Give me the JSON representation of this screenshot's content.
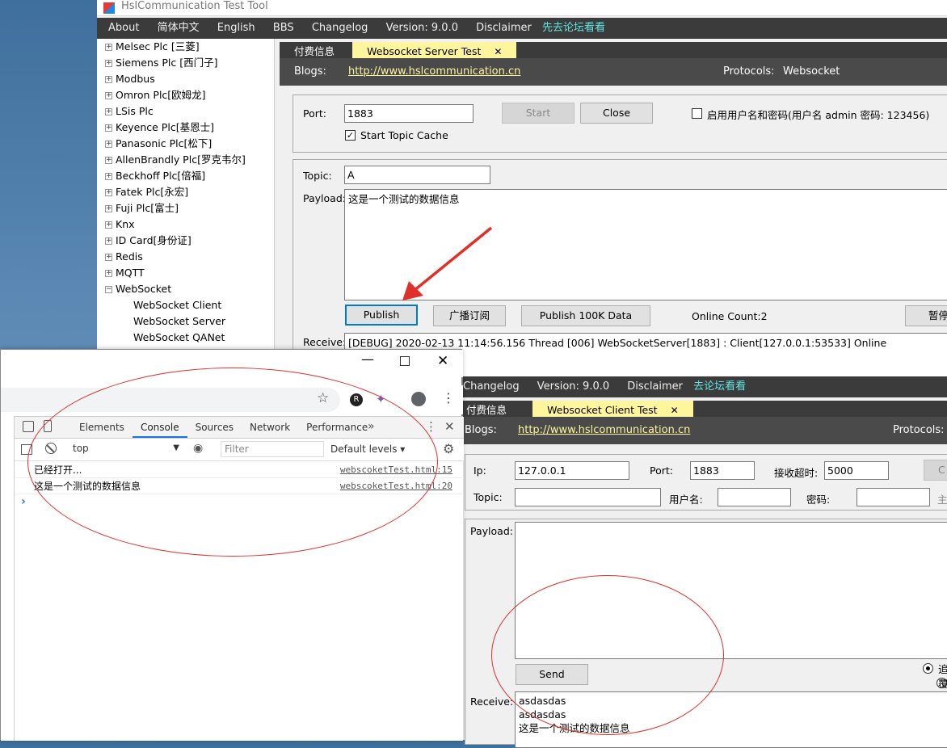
{
  "server_window": {
    "title": "HslCommunication Test Tool",
    "menu": [
      "About",
      "简体中文",
      "English",
      "BBS",
      "Changelog",
      "Version: 9.0.0",
      "Disclaimer",
      "先去论坛看看"
    ],
    "tree": {
      "items": [
        {
          "label": "Melsec Plc [三菱]"
        },
        {
          "label": "Siemens Plc [西门子]"
        },
        {
          "label": "Modbus"
        },
        {
          "label": "Omron Plc[欧姆龙]"
        },
        {
          "label": "LSis Plc"
        },
        {
          "label": "Keyence Plc[基恩士]"
        },
        {
          "label": "Panasonic Plc[松下]"
        },
        {
          "label": "AllenBrandly Plc[罗克韦尔]"
        },
        {
          "label": "Beckhoff Plc[倍福]"
        },
        {
          "label": "Fatek Plc[永宏]"
        },
        {
          "label": "Fuji Plc[富士]"
        },
        {
          "label": "Knx"
        },
        {
          "label": "ID Card[身份证]"
        },
        {
          "label": "Redis"
        },
        {
          "label": "MQTT"
        },
        {
          "label": "WebSocket"
        }
      ],
      "children": [
        "WebSocket Client",
        "WebSocket Server",
        "WebSocket QANet"
      ]
    },
    "tabs": [
      "付费信息",
      "Websocket Server Test"
    ],
    "blogs_label": "Blogs:",
    "blogs_url": "http://www.hslcommunication.cn",
    "protocols_label": "Protocols:",
    "protocols_value": "Websocket",
    "port_label": "Port:",
    "port_value": "1883",
    "start_label": "Start",
    "close_label": "Close",
    "auth_label": "启用用户名和密码(用户名 admin  密码: 123456)",
    "topic_cache_label": "Start Topic Cache",
    "topic_label": "Topic:",
    "topic_value": "A",
    "payload_label": "Payload:",
    "payload_value": "这是一个测试的数据信息",
    "publish_label": "Publish",
    "broadcast_label": "广播订阅",
    "publish100k_label": "Publish 100K Data",
    "online_count": "Online Count:2",
    "pause_label": "暂停",
    "receive_label": "Receive:",
    "receive_line": "[DEBUG] 2020-02-13 11:14:56.156 Thread [006] WebSocketServer[1883] : Client[127.0.0.1:53533] Online"
  },
  "client_window": {
    "menu": [
      "Changelog",
      "Version: 9.0.0",
      "Disclaimer",
      "去论坛看看"
    ],
    "tabs": [
      "付费信息",
      "Websocket Client Test"
    ],
    "blogs_label": "Blogs:",
    "blogs_url": "http://www.hslcommunication.cn",
    "protocols_label": "Protocols:",
    "ip_label": "Ip:",
    "ip_value": "127.0.0.1",
    "port_label": "Port:",
    "port_value": "1883",
    "timeout_label": "接收超时:",
    "timeout_value": "5000",
    "connect_partial": "C",
    "topic_label": "Topic:",
    "user_label": "用户名:",
    "pwd_label": "密码:",
    "extra_partial": "主",
    "payload_label": "Payload:",
    "send_label": "Send",
    "radio1_partial": "追",
    "radio2_partial": "覆",
    "receive_label": "Receive:",
    "receive_lines": [
      "asdasdas",
      "asdasdas",
      "这是一个测试的数据信息"
    ]
  },
  "browser": {
    "devtools_tabs": [
      "Elements",
      "Console",
      "Sources",
      "Network",
      "Performance"
    ],
    "context": "top",
    "filter_placeholder": "Filter",
    "levels": "Default levels ▾",
    "console_lines": [
      {
        "text": "已经打开...",
        "src": "webscoketTest.html:15"
      },
      {
        "text": "这是一个测试的数据信息",
        "src": "webscoketTest.html:20"
      }
    ],
    "prompt": "›"
  },
  "colors": {
    "annotation": "#e0302a",
    "accent": "#fff59d",
    "dark": "#3b3b3b"
  }
}
